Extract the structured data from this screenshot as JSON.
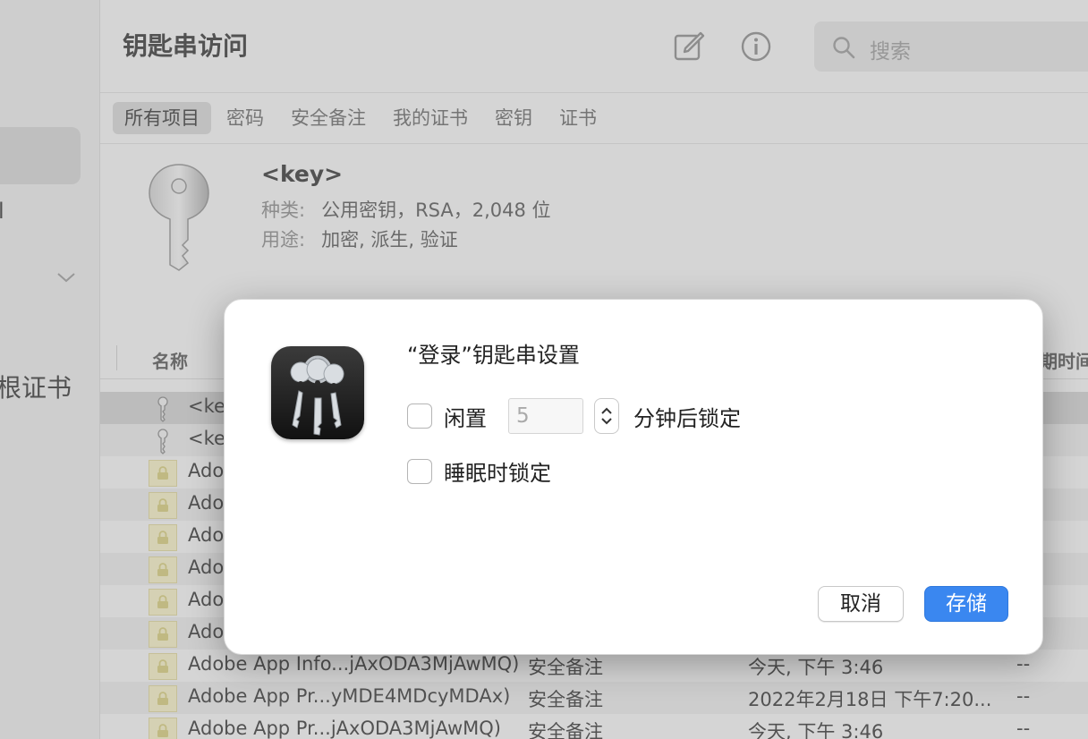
{
  "window": {
    "title": "钥匙串访问",
    "search_placeholder": "搜索",
    "icons": {
      "compose": "compose-icon",
      "info": "info-icon",
      "search": "magnifier-icon"
    },
    "tabs": [
      "所有项目",
      "密码",
      "安全备注",
      "我的证书",
      "密钥",
      "证书"
    ],
    "active_tab": "所有项目"
  },
  "sidebar": {
    "fragment_top": "l",
    "fragment_bottom": "根证书"
  },
  "detail": {
    "name": "<key>",
    "kind_label": "种类:",
    "kind_value": "公用密钥，RSA，2,048 位",
    "usage_label": "用途:",
    "usage_value": "加密, 派生, 验证"
  },
  "list": {
    "col_name": "名称",
    "col_date_fragment": "期时间",
    "rows": [
      {
        "name": "<key>",
        "icon": "key-icon"
      },
      {
        "name": "<key>",
        "icon": "key-icon"
      },
      {
        "name": "Adobe",
        "icon": "lock-icon"
      },
      {
        "name": "Adobe",
        "icon": "lock-icon"
      },
      {
        "name": "Adobe",
        "icon": "lock-icon"
      },
      {
        "name": "Adobe",
        "icon": "lock-icon"
      },
      {
        "name": "Adobe",
        "icon": "lock-icon"
      },
      {
        "name": "Adobe",
        "icon": "lock-icon"
      },
      {
        "name": "Adobe App Info...jAxODA3MjAwMQ)",
        "kind": "安全备注",
        "date": "今天, 下午 3:46",
        "expires": "--",
        "icon": "lock-icon"
      },
      {
        "name": "Adobe App Pr...yMDE4MDcyMDAx)",
        "kind": "安全备注",
        "date": "2022年2月18日 下午7:20...",
        "expires": "--",
        "icon": "lock-icon"
      },
      {
        "name": "Adobe App Pr...jAxODA3MjAwMQ)",
        "kind": "安全备注",
        "date": "今天, 下午 3:46",
        "expires": "--",
        "icon": "lock-icon"
      }
    ]
  },
  "dialog": {
    "title": "“登录”钥匙串设置",
    "idle_label": "闲置",
    "idle_minutes": "5",
    "minutes_label": "分钟后锁定",
    "sleep_label": "睡眠时锁定",
    "idle_checked": false,
    "sleep_checked": false,
    "cancel_label": "取消",
    "save_label": "存储",
    "accent_color": "#3a87f0"
  }
}
